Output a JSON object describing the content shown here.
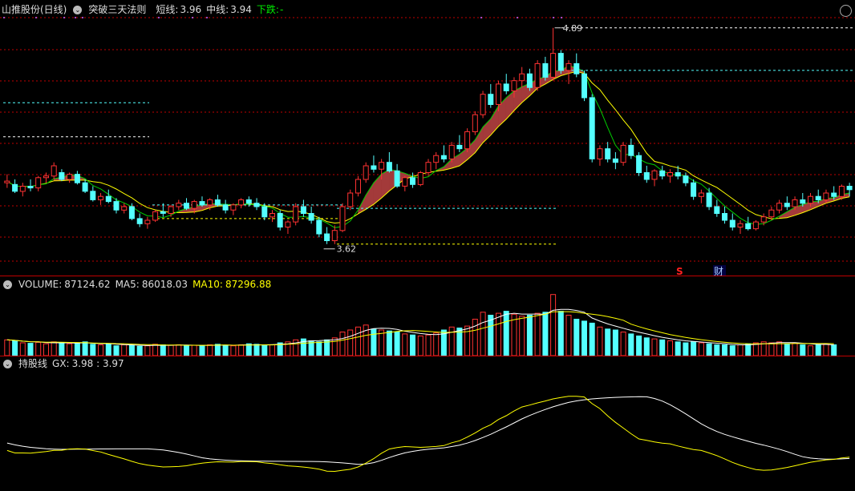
{
  "header": {
    "stock_name": "山推股份(日线)",
    "indicator_name": "突破三天法则",
    "short_label": "短线:",
    "short_value": "3.96",
    "mid_label": "中线:",
    "mid_value": "3.94",
    "trend_label": "下跌:",
    "trend_value": "-"
  },
  "volume_header": {
    "label": "VOLUME:",
    "volume": "87124.62",
    "ma5_label": "MA5:",
    "ma5": "86018.03",
    "ma10_label": "MA10:",
    "ma10": "87296.88"
  },
  "gx_header": {
    "label": "持股线",
    "gx_label": "GX:",
    "gx_values": "3.98 : 3.97"
  },
  "price_annotations": {
    "high": "4.89",
    "low": "3.62",
    "marker_s": "S",
    "marker_cai": "财"
  },
  "colors": {
    "up": "#ff3232",
    "down": "#54ffff",
    "band": "#a33a3a",
    "ma_green": "#00cc00",
    "ma_yellow": "#ffff00",
    "white": "#ffffff",
    "grid": "#c00000"
  },
  "chart_data": {
    "type": "candlestick",
    "price_range": [
      3.52,
      4.95
    ],
    "candles": [
      [
        3.98,
        4.03,
        3.95,
        3.99
      ],
      [
        3.97,
        4.0,
        3.92,
        3.93
      ],
      [
        3.93,
        3.98,
        3.9,
        3.96
      ],
      [
        3.96,
        4.0,
        3.93,
        3.95
      ],
      [
        3.95,
        4.02,
        3.93,
        4.01
      ],
      [
        4.01,
        4.04,
        3.98,
        4.02
      ],
      [
        4.02,
        4.1,
        4.0,
        4.08
      ],
      [
        4.04,
        4.06,
        3.99,
        4.0
      ],
      [
        4.0,
        4.04,
        3.98,
        4.03
      ],
      [
        4.03,
        4.05,
        3.97,
        3.98
      ],
      [
        3.98,
        4.0,
        3.92,
        3.93
      ],
      [
        3.93,
        3.96,
        3.87,
        3.88
      ],
      [
        3.88,
        3.92,
        3.85,
        3.9
      ],
      [
        3.9,
        3.94,
        3.86,
        3.87
      ],
      [
        3.87,
        3.89,
        3.8,
        3.82
      ],
      [
        3.82,
        3.86,
        3.8,
        3.84
      ],
      [
        3.84,
        3.86,
        3.76,
        3.77
      ],
      [
        3.77,
        3.8,
        3.72,
        3.74
      ],
      [
        3.74,
        3.78,
        3.71,
        3.76
      ],
      [
        3.76,
        3.82,
        3.75,
        3.81
      ],
      [
        3.81,
        3.86,
        3.78,
        3.8
      ],
      [
        3.8,
        3.85,
        3.78,
        3.84
      ],
      [
        3.84,
        3.88,
        3.82,
        3.86
      ],
      [
        3.86,
        3.89,
        3.82,
        3.83
      ],
      [
        3.83,
        3.88,
        3.8,
        3.87
      ],
      [
        3.87,
        3.9,
        3.84,
        3.85
      ],
      [
        3.85,
        3.89,
        3.82,
        3.88
      ],
      [
        3.88,
        3.91,
        3.84,
        3.85
      ],
      [
        3.85,
        3.88,
        3.8,
        3.82
      ],
      [
        3.82,
        3.86,
        3.79,
        3.85
      ],
      [
        3.85,
        3.89,
        3.83,
        3.88
      ],
      [
        3.88,
        3.9,
        3.84,
        3.86
      ],
      [
        3.86,
        3.89,
        3.82,
        3.84
      ],
      [
        3.84,
        3.86,
        3.76,
        3.78
      ],
      [
        3.78,
        3.82,
        3.75,
        3.8
      ],
      [
        3.8,
        3.82,
        3.7,
        3.72
      ],
      [
        3.72,
        3.76,
        3.68,
        3.75
      ],
      [
        3.75,
        3.86,
        3.73,
        3.84
      ],
      [
        3.84,
        3.88,
        3.78,
        3.8
      ],
      [
        3.8,
        3.84,
        3.74,
        3.76
      ],
      [
        3.76,
        3.78,
        3.66,
        3.68
      ],
      [
        3.68,
        3.72,
        3.62,
        3.64
      ],
      [
        3.64,
        3.73,
        3.62,
        3.7
      ],
      [
        3.7,
        3.86,
        3.69,
        3.84
      ],
      [
        3.84,
        3.94,
        3.82,
        3.92
      ],
      [
        3.92,
        4.02,
        3.9,
        4.0
      ],
      [
        4.0,
        4.1,
        3.98,
        4.08
      ],
      [
        4.08,
        4.14,
        4.04,
        4.06
      ],
      [
        4.06,
        4.12,
        4.0,
        4.1
      ],
      [
        4.1,
        4.16,
        4.04,
        4.05
      ],
      [
        4.05,
        4.09,
        3.95,
        3.96
      ],
      [
        3.96,
        4.02,
        3.93,
        4.01
      ],
      [
        4.01,
        4.04,
        3.95,
        3.97
      ],
      [
        3.97,
        4.05,
        3.96,
        4.04
      ],
      [
        4.04,
        4.12,
        4.02,
        4.1
      ],
      [
        4.1,
        4.16,
        4.06,
        4.14
      ],
      [
        4.14,
        4.2,
        4.1,
        4.12
      ],
      [
        4.12,
        4.22,
        4.1,
        4.2
      ],
      [
        4.2,
        4.26,
        4.16,
        4.18
      ],
      [
        4.18,
        4.3,
        4.16,
        4.28
      ],
      [
        4.28,
        4.4,
        4.26,
        4.38
      ],
      [
        4.38,
        4.52,
        4.36,
        4.5
      ],
      [
        4.5,
        4.56,
        4.42,
        4.44
      ],
      [
        4.44,
        4.58,
        4.4,
        4.56
      ],
      [
        4.56,
        4.62,
        4.5,
        4.52
      ],
      [
        4.52,
        4.6,
        4.48,
        4.58
      ],
      [
        4.58,
        4.66,
        4.54,
        4.62
      ],
      [
        4.62,
        4.65,
        4.52,
        4.54
      ],
      [
        4.54,
        4.7,
        4.52,
        4.68
      ],
      [
        4.68,
        4.72,
        4.58,
        4.6
      ],
      [
        4.6,
        4.89,
        4.58,
        4.74
      ],
      [
        4.74,
        4.76,
        4.62,
        4.64
      ],
      [
        4.64,
        4.7,
        4.56,
        4.68
      ],
      [
        4.68,
        4.74,
        4.6,
        4.62
      ],
      [
        4.62,
        4.64,
        4.46,
        4.48
      ],
      [
        4.48,
        4.5,
        4.1,
        4.12
      ],
      [
        4.12,
        4.2,
        4.08,
        4.18
      ],
      [
        4.18,
        4.22,
        4.1,
        4.12
      ],
      [
        4.12,
        4.16,
        4.06,
        4.1
      ],
      [
        4.1,
        4.22,
        4.08,
        4.2
      ],
      [
        4.2,
        4.24,
        4.12,
        4.14
      ],
      [
        4.14,
        4.16,
        4.02,
        4.04
      ],
      [
        4.04,
        4.08,
        3.98,
        4.0
      ],
      [
        4.0,
        4.06,
        3.96,
        4.05
      ],
      [
        4.05,
        4.08,
        4.0,
        4.02
      ],
      [
        4.02,
        4.06,
        3.98,
        4.04
      ],
      [
        4.04,
        4.08,
        4.0,
        4.02
      ],
      [
        4.02,
        4.04,
        3.96,
        3.98
      ],
      [
        3.98,
        4.0,
        3.88,
        3.9
      ],
      [
        3.9,
        3.94,
        3.86,
        3.92
      ],
      [
        3.92,
        3.95,
        3.82,
        3.84
      ],
      [
        3.84,
        3.88,
        3.78,
        3.8
      ],
      [
        3.8,
        3.84,
        3.74,
        3.76
      ],
      [
        3.76,
        3.8,
        3.7,
        3.72
      ],
      [
        3.72,
        3.76,
        3.68,
        3.74
      ],
      [
        3.74,
        3.78,
        3.7,
        3.71
      ],
      [
        3.71,
        3.76,
        3.7,
        3.75
      ],
      [
        3.75,
        3.8,
        3.73,
        3.78
      ],
      [
        3.78,
        3.84,
        3.76,
        3.82
      ],
      [
        3.82,
        3.88,
        3.8,
        3.86
      ],
      [
        3.86,
        3.9,
        3.82,
        3.84
      ],
      [
        3.84,
        3.9,
        3.82,
        3.88
      ],
      [
        3.88,
        3.92,
        3.84,
        3.86
      ],
      [
        3.86,
        3.92,
        3.84,
        3.9
      ],
      [
        3.9,
        3.94,
        3.86,
        3.88
      ],
      [
        3.88,
        3.94,
        3.86,
        3.92
      ],
      [
        3.92,
        3.96,
        3.88,
        3.9
      ],
      [
        3.9,
        3.97,
        3.88,
        3.96
      ],
      [
        3.96,
        3.98,
        3.9,
        3.94
      ]
    ],
    "volume_range": [
      0,
      130000
    ],
    "volume": [
      32000,
      30000,
      26000,
      25000,
      27000,
      24000,
      28000,
      26000,
      24000,
      25000,
      28000,
      23000,
      22000,
      24000,
      20000,
      22000,
      21000,
      19000,
      20000,
      23000,
      22000,
      21000,
      22000,
      20000,
      21000,
      20000,
      22000,
      23000,
      21000,
      20000,
      22000,
      24000,
      23000,
      21000,
      22000,
      26000,
      28000,
      32000,
      34000,
      30000,
      28000,
      32000,
      36000,
      48000,
      52000,
      58000,
      62000,
      54000,
      52000,
      50000,
      48000,
      44000,
      42000,
      40000,
      42000,
      46000,
      52000,
      58000,
      56000,
      60000,
      74000,
      88000,
      82000,
      86000,
      90000,
      84000,
      80000,
      82000,
      86000,
      88000,
      124000,
      90000,
      82000,
      74000,
      70000,
      66000,
      58000,
      54000,
      52000,
      48000,
      44000,
      40000,
      36000,
      34000,
      32000,
      30000,
      28000,
      26000,
      28000,
      26000,
      24000,
      22000,
      22000,
      20000,
      22000,
      24000,
      26000,
      28000,
      26000,
      28000,
      24000,
      26000,
      22000,
      20000,
      22000,
      24000,
      22000
    ]
  }
}
